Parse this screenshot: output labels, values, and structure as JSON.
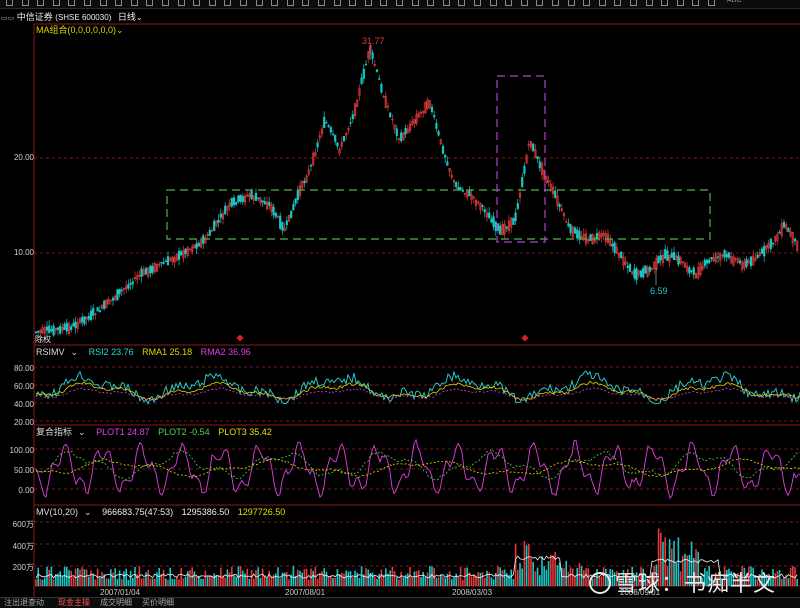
{
  "colors": {
    "up": "#e23a3a",
    "down": "#19c6c6",
    "ma": "#cccc00",
    "rsi": "#28d8d8",
    "rma1": "#d8d800",
    "rma2": "#e040e0",
    "plot1": "#e040e0",
    "plot2": "#4cd84c",
    "plot3": "#e0e000",
    "mv": "#f0f0f0",
    "grid": "#7a1818",
    "box_green": "#55b050",
    "box_purple": "#b040d0",
    "marker": "#e02020"
  },
  "titlebar": {
    "prefix": "▭▭",
    "stock": "中信证券",
    "code": "(SHSE 600030)",
    "period": "日线"
  },
  "main": {
    "indicator": "MA组合(0,0,0,0,0,0)",
    "y_labels": [
      "20.00",
      "10.00"
    ],
    "high_label": "31.77",
    "low_label": "6.59",
    "corner_label": "除权"
  },
  "rsi": {
    "name": "RSIMV",
    "items": [
      {
        "label": "RSI2 23.76"
      },
      {
        "label": "RMA1 25.18"
      },
      {
        "label": "RMA2 36.96"
      }
    ],
    "y_labels": [
      "80.00",
      "60.00",
      "40.00",
      "20.00"
    ]
  },
  "comp": {
    "name": "复合指标",
    "items": [
      {
        "label": "PLOT1 24.87"
      },
      {
        "label": "PLOT2 -0.54"
      },
      {
        "label": "PLOT3 35.42"
      }
    ],
    "y_labels": [
      "100.00",
      "50.00",
      "0.00"
    ]
  },
  "mv": {
    "name": "MV(10,20)",
    "items": [
      {
        "label": "966683.75(47:53)"
      },
      {
        "label": "1295386.50"
      },
      {
        "label": "1297726.50"
      }
    ],
    "y_labels": [
      "600万",
      "400万",
      "200万"
    ]
  },
  "x_labels": [
    "2007/01/04",
    "2007/08/01",
    "2008/03/03",
    "2008/09/01"
  ],
  "bottom_tabs": [
    "注出退查动",
    "现金主操",
    "成交明细",
    "买价明细"
  ],
  "watermark": "雪球：书痴半文",
  "toolbar_right": [
    "ABC"
  ]
}
